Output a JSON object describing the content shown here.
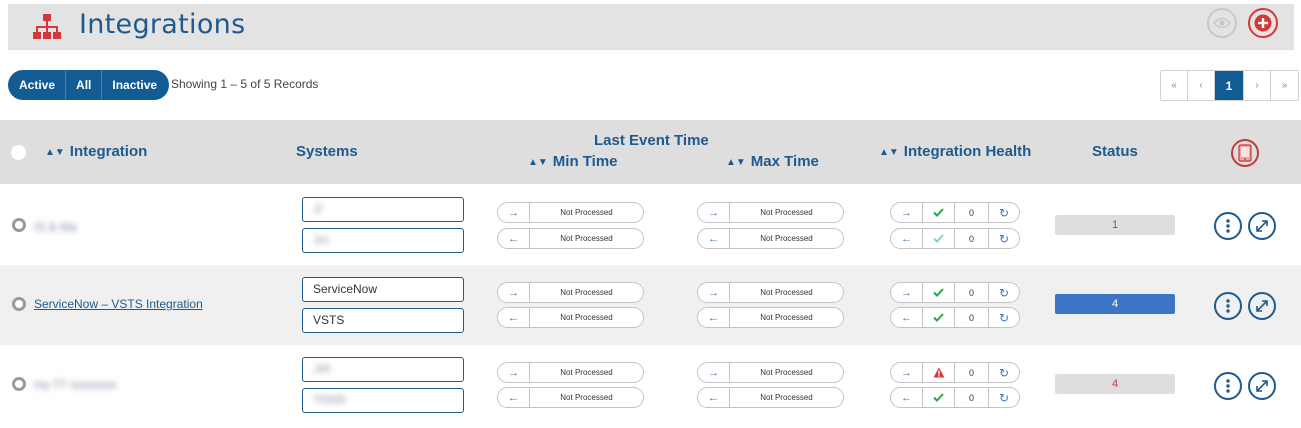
{
  "header": {
    "title": "Integrations",
    "icons": {
      "title": "sitemap-icon",
      "visibility": "eye-icon",
      "add": "plus-icon"
    }
  },
  "filters": {
    "active": "Active",
    "all": "All",
    "inactive": "Inactive"
  },
  "record_count": "Showing 1 – 5 of 5 Records",
  "pagination": {
    "first": "«",
    "prev": "‹",
    "current": "1",
    "next": "›",
    "last": "»"
  },
  "columns": {
    "integration": "Integration",
    "systems": "Systems",
    "last_event_time": "Last Event Time",
    "min_time": "Min Time",
    "max_time": "Max Time",
    "integration_health": "Integration Health",
    "status": "Status"
  },
  "rows": [
    {
      "name": "IS & Ma",
      "name_blurred": true,
      "systems": [
        "JI",
        "Jm"
      ],
      "systems_blurred": true,
      "min_time": [
        "Not Processed",
        "Not Processed"
      ],
      "max_time": [
        "Not Processed",
        "Not Processed"
      ],
      "health": [
        {
          "state": "ok",
          "count": "0"
        },
        {
          "state": "ok-faded",
          "count": "0"
        }
      ],
      "status": "1",
      "status_active": false
    },
    {
      "name": "ServiceNow – VSTS Integration",
      "name_blurred": false,
      "systems": [
        "ServiceNow",
        "VSTS"
      ],
      "systems_blurred": false,
      "min_time": [
        "Not Processed",
        "Not Processed"
      ],
      "max_time": [
        "Not Processed",
        "Not Processed"
      ],
      "health": [
        {
          "state": "ok",
          "count": "0"
        },
        {
          "state": "ok",
          "count": "0"
        }
      ],
      "status": "4",
      "status_active": true
    },
    {
      "name": "Ha TT nnnnnnn",
      "name_blurred": true,
      "systems": [
        "JIR",
        "TRRR"
      ],
      "systems_blurred": true,
      "min_time": [
        "Not Processed",
        "Not Processed"
      ],
      "max_time": [
        "Not Processed",
        "Not Processed"
      ],
      "health": [
        {
          "state": "warning",
          "count": "0"
        },
        {
          "state": "ok",
          "count": "0"
        }
      ],
      "status": "4",
      "status_active": false
    }
  ],
  "colors": {
    "brand_blue": "#135b93",
    "title_blue": "#1f5a8f",
    "danger_red": "#d8373a",
    "ok_green": "#2ea44f",
    "status_active": "#3c75c3"
  }
}
